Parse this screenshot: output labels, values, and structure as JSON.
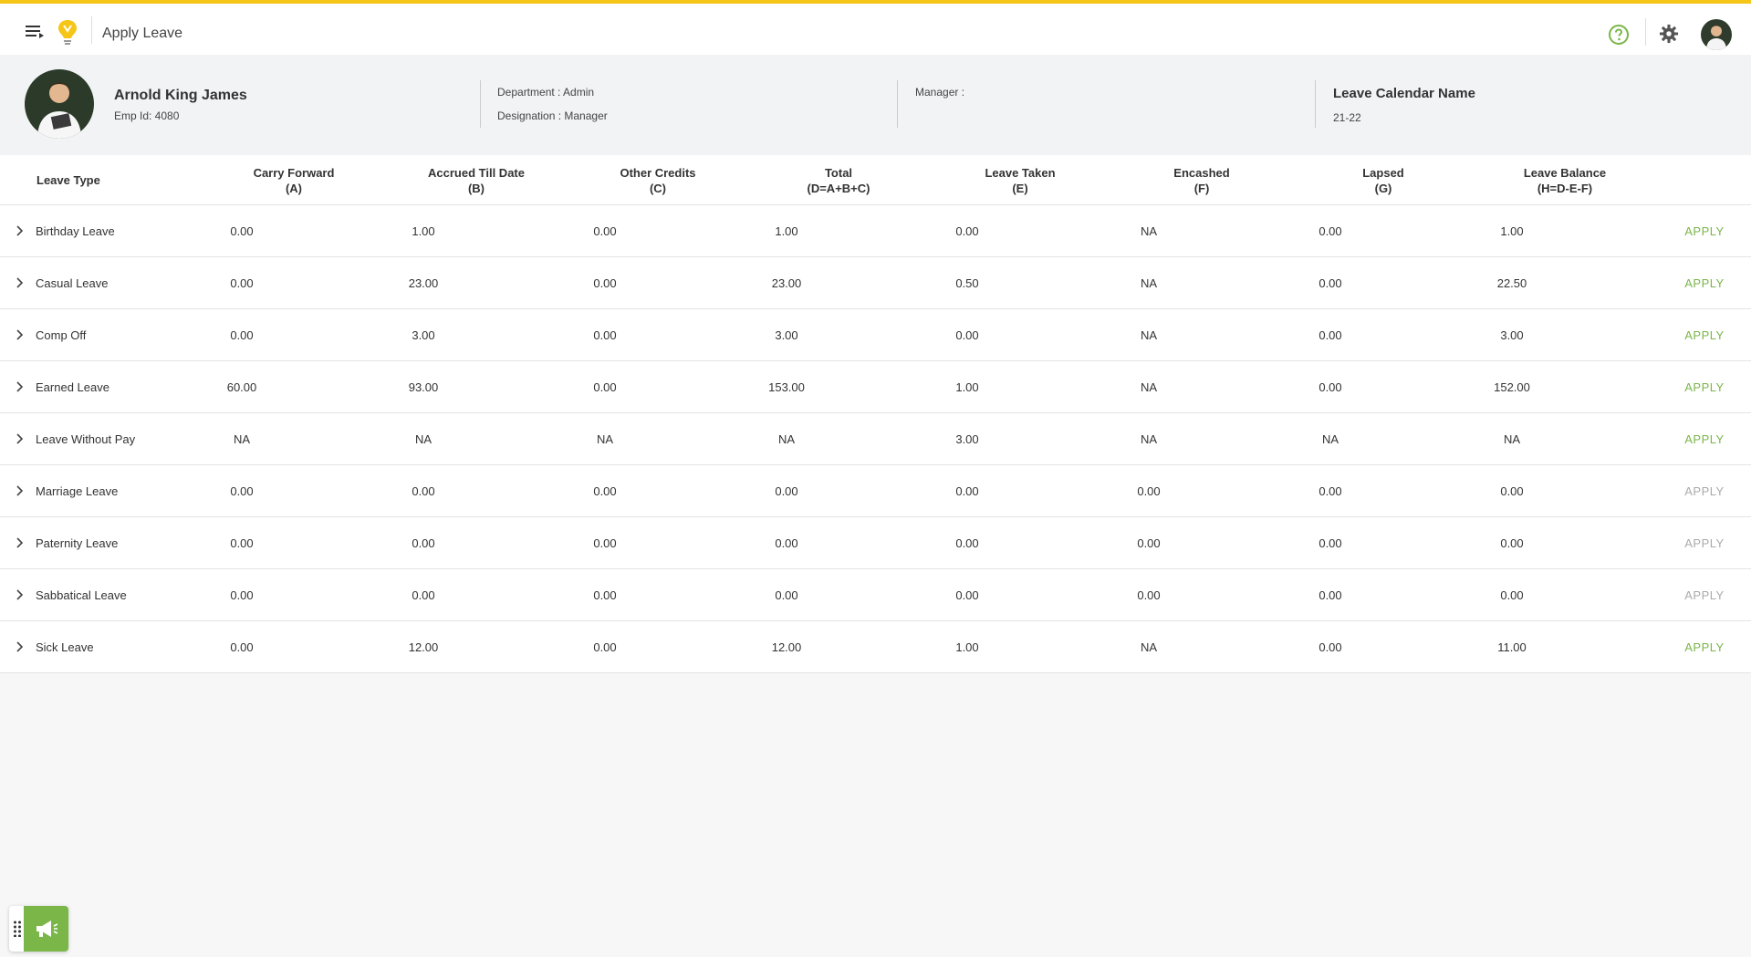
{
  "header": {
    "title": "Apply Leave"
  },
  "profile": {
    "name": "Arnold King James",
    "emp_id": "Emp Id: 4080",
    "department": "Department : Admin",
    "designation": "Designation : Manager",
    "manager": "Manager :",
    "calendar_title": "Leave Calendar Name",
    "calendar_value": "21-22"
  },
  "colors": {
    "accent": "#f5c518",
    "apply_active": "#7ab648",
    "apply_disabled": "#aaaaaa"
  },
  "table": {
    "headers": [
      {
        "line1": "Leave Type",
        "line2": ""
      },
      {
        "line1": "Carry Forward",
        "line2": "(A)"
      },
      {
        "line1": "Accrued Till Date",
        "line2": "(B)"
      },
      {
        "line1": "Other Credits",
        "line2": "(C)"
      },
      {
        "line1": "Total",
        "line2": "(D=A+B+C)"
      },
      {
        "line1": "Leave Taken",
        "line2": "(E)"
      },
      {
        "line1": "Encashed",
        "line2": "(F)"
      },
      {
        "line1": "Lapsed",
        "line2": "(G)"
      },
      {
        "line1": "Leave Balance",
        "line2": "(H=D-E-F)"
      }
    ],
    "rows": [
      {
        "type": "Birthday Leave",
        "a": "0.00",
        "b": "1.00",
        "c": "0.00",
        "d": "1.00",
        "e": "0.00",
        "f": "NA",
        "g": "0.00",
        "h": "1.00",
        "action": "APPLY",
        "enabled": true
      },
      {
        "type": "Casual Leave",
        "a": "0.00",
        "b": "23.00",
        "c": "0.00",
        "d": "23.00",
        "e": "0.50",
        "f": "NA",
        "g": "0.00",
        "h": "22.50",
        "action": "APPLY",
        "enabled": true
      },
      {
        "type": "Comp Off",
        "a": "0.00",
        "b": "3.00",
        "c": "0.00",
        "d": "3.00",
        "e": "0.00",
        "f": "NA",
        "g": "0.00",
        "h": "3.00",
        "action": "APPLY",
        "enabled": true
      },
      {
        "type": "Earned Leave",
        "a": "60.00",
        "b": "93.00",
        "c": "0.00",
        "d": "153.00",
        "e": "1.00",
        "f": "NA",
        "g": "0.00",
        "h": "152.00",
        "action": "APPLY",
        "enabled": true
      },
      {
        "type": "Leave Without Pay",
        "a": "NA",
        "b": "NA",
        "c": "NA",
        "d": "NA",
        "e": "3.00",
        "f": "NA",
        "g": "NA",
        "h": "NA",
        "action": "APPLY",
        "enabled": true
      },
      {
        "type": "Marriage Leave",
        "a": "0.00",
        "b": "0.00",
        "c": "0.00",
        "d": "0.00",
        "e": "0.00",
        "f": "0.00",
        "g": "0.00",
        "h": "0.00",
        "action": "APPLY",
        "enabled": false
      },
      {
        "type": "Paternity Leave",
        "a": "0.00",
        "b": "0.00",
        "c": "0.00",
        "d": "0.00",
        "e": "0.00",
        "f": "0.00",
        "g": "0.00",
        "h": "0.00",
        "action": "APPLY",
        "enabled": false
      },
      {
        "type": "Sabbatical Leave",
        "a": "0.00",
        "b": "0.00",
        "c": "0.00",
        "d": "0.00",
        "e": "0.00",
        "f": "0.00",
        "g": "0.00",
        "h": "0.00",
        "action": "APPLY",
        "enabled": false
      },
      {
        "type": "Sick Leave",
        "a": "0.00",
        "b": "12.00",
        "c": "0.00",
        "d": "12.00",
        "e": "1.00",
        "f": "NA",
        "g": "0.00",
        "h": "11.00",
        "action": "APPLY",
        "enabled": true
      }
    ]
  },
  "icons": {
    "menu": "menu-icon",
    "logo": "lightbulb-logo-icon",
    "help": "help-circle-icon",
    "settings": "gear-icon",
    "avatar": "user-avatar",
    "expand": "chevron-right-icon",
    "announcement": "megaphone-icon",
    "drag": "drag-grip-icon"
  }
}
